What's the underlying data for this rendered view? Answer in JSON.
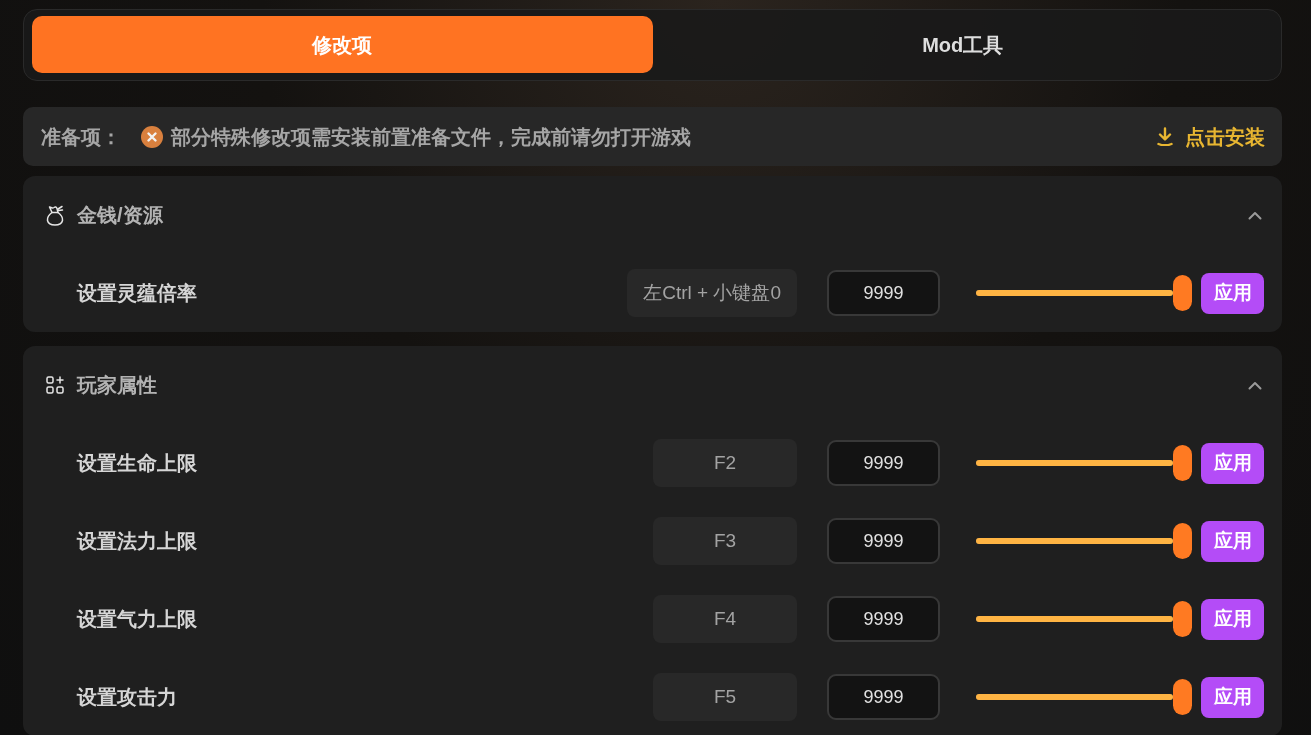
{
  "tabs": [
    {
      "label": "修改项",
      "selected": true
    },
    {
      "label": "Mod工具",
      "selected": false
    }
  ],
  "prerequisite": {
    "label": "准备项：",
    "ready": false,
    "message": "部分特殊修改项需安装前置准备文件，完成前请勿打开游戏",
    "action": "点击安装"
  },
  "sections": [
    {
      "kind": "resources",
      "title": "金钱/资源",
      "expanded": true,
      "items": [
        {
          "label": "设置灵蕴倍率",
          "hotkey": "左Ctrl + 小键盘0",
          "value": "9999",
          "level": 1,
          "button": "应用"
        }
      ]
    },
    {
      "kind": "player",
      "title": "玩家属性",
      "expanded": true,
      "items": [
        {
          "label": "设置生命上限",
          "hotkey": "F2",
          "value": "9999",
          "level": 1,
          "button": "应用"
        },
        {
          "label": "设置法力上限",
          "hotkey": "F3",
          "value": "9999",
          "level": 1,
          "button": "应用"
        },
        {
          "label": "设置气力上限",
          "hotkey": "F4",
          "value": "9999",
          "level": 1,
          "button": "应用"
        },
        {
          "label": "设置攻击力",
          "hotkey": "F5",
          "value": "9999",
          "level": 1,
          "button": "应用"
        }
      ]
    }
  ]
}
